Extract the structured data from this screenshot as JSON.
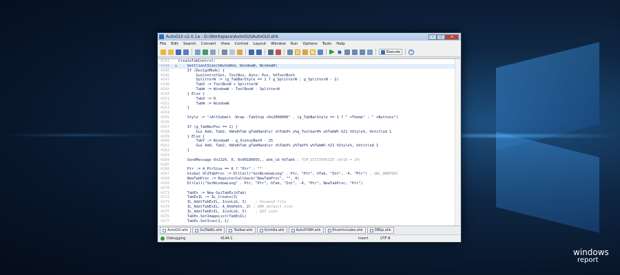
{
  "window": {
    "title": "AutoGUI v2.0.1a - D:\\Workspace\\AutoGUI\\AutoGUI.ahk",
    "buttons": [
      "–",
      "□",
      "✕"
    ]
  },
  "menu": [
    "File",
    "Edit",
    "Search",
    "Convert",
    "View",
    "Control",
    "Layout",
    "Window",
    "Run",
    "Options",
    "Tools",
    "Help"
  ],
  "toolbar": {
    "execute_label": "Execute",
    "help_icon": "?"
  },
  "editor": {
    "current_line": "4144",
    "lines": [
      {
        "n": "4143",
        "code": "CreateTabControl:",
        "cmt": ""
      },
      {
        "n": "4144",
        "code": "    GetClientSize(hAutoWnd, WindowW, WindowH)",
        "cmt": ""
      },
      {
        "n": "4145",
        "code": "    If (DesignMode) {",
        "cmt": ""
      },
      {
        "n": "4146",
        "code": "        GuiControlGet, ToolBox, Auto: Pos, %hToolBox%",
        "cmt": ""
      },
      {
        "n": "4147",
        "code": "        SplitterW := (g_TabBarStyle == 1 ? g_SplitterW : g_SplitterW - 2)",
        "cmt": ""
      },
      {
        "n": "4148",
        "code": "        TabX := ToolBoxW + SplitterW",
        "cmt": ""
      },
      {
        "n": "4149",
        "code": "        TabW := WindowW - ToolBoxW - SplitterW",
        "cmt": ""
      },
      {
        "n": "4150",
        "code": "    } Else {",
        "cmt": ""
      },
      {
        "n": "4151",
        "code": "        TabX := 0",
        "cmt": ""
      },
      {
        "n": "4152",
        "code": "        TabW := WindowW",
        "cmt": ""
      },
      {
        "n": "4153",
        "code": "    }",
        "cmt": ""
      },
      {
        "n": "4154",
        "code": "",
        "cmt": ""
      },
      {
        "n": "4155",
        "code": "    Style := \"+AltSubmit -Wrap -TabStop +0x2008000\" . (g_TabBarStyle == 1 ? \" +Theme\" : \" +Buttons\")",
        "cmt": ""
      },
      {
        "n": "4156",
        "code": "",
        "cmt": ""
      },
      {
        "n": "4157",
        "code": "    If (g_TabBarPos == 1) {",
        "cmt": ""
      },
      {
        "n": "4158",
        "code": "        Gui Add, Tab2, hWndhTab gTabHandler x%TabX% y%g_ToolbarH% w%TabW% h21 %Style%, Untitled 1",
        "cmt": ""
      },
      {
        "n": "4159",
        "code": "    } Else {",
        "cmt": ""
      },
      {
        "n": "4160",
        "code": "        TabY := WindowH - g_StatusBarH - 25",
        "cmt": ""
      },
      {
        "n": "4161",
        "code": "        Gui Add, Tab2, hWndhTab gTabHandler x%TabX% y%TabY% w%TabW% h21 %Style%, Untitled 1",
        "cmt": ""
      },
      {
        "n": "4162",
        "code": "    }",
        "cmt": ""
      },
      {
        "n": "4163",
        "code": "",
        "cmt": ""
      },
      {
        "n": "4164",
        "code": "    SendMessage 0x1329, 0, 0x00180055,, ahk_id %hTab% ",
        "cmt": "; TCM_SETITEMSIZE (0x18 = 24)"
      },
      {
        "n": "4165",
        "code": "",
        "cmt": ""
      },
      {
        "n": "4166",
        "code": "    Ptr := A_PtrSize == 8 ? \"Ptr\" : \"\"",
        "cmt": ""
      },
      {
        "n": "4167",
        "code": "    Global OldTabProc := DllCall(\"GetWindowLong\" . Ptr, \"Ptr\", hTab, \"Int\", -4, \"Ptr\") ",
        "cmt": "; GWL_WNDPROC"
      },
      {
        "n": "4168",
        "code": "    NewTabProc := RegisterCallback(\"NewTabProc\", \"\", 4) ",
        "cmt": ";"
      },
      {
        "n": "4169",
        "code": "    DllCall(\"SetWindowLong\" . Ptr, \"Ptr\", hTab, \"Int\", -4, \"Ptr\", NewTabProc, \"Ptr\")",
        "cmt": ""
      },
      {
        "n": "4170",
        "code": "",
        "cmt": ""
      },
      {
        "n": "4171",
        "code": "    TabEx := New GuiTabEx(hTab)",
        "cmt": ""
      },
      {
        "n": "4172",
        "code": "    TabExIL := IL_Create(3)",
        "cmt": ""
      },
      {
        "n": "4173",
        "code": "    IL_Add(TabExIL, IconLib, 3)    ",
        "cmt": "; Unsaved file"
      },
      {
        "n": "4174",
        "code": "    IL_Add(TabExIL, A_AhkPath, 2) ",
        "cmt": "; AHK default icon"
      },
      {
        "n": "4175",
        "code": "    IL_Add(TabExIL, IconLib, 5)    ",
        "cmt": "; GUI icon"
      },
      {
        "n": "4176",
        "code": "    TabEx.SetImageList(TabExIL)",
        "cmt": ""
      },
      {
        "n": "4177",
        "code": "    TabEx.SetIcon(1, 1)",
        "cmt": ""
      }
    ]
  },
  "tabs": [
    "AutoGUI.ahk",
    "GuiTabEx.ahk",
    "Toolbar.ahk",
    "Scintilla.ahk",
    "AutoXYWH.ahk",
    "EnumIncludes.ahk",
    "DBGp.ahk"
  ],
  "status": {
    "mode": "Debugging",
    "position": "4144:1",
    "insert": "Insert",
    "encoding": "UTF-8"
  },
  "watermark": {
    "line1": "windows",
    "line2": "report"
  }
}
